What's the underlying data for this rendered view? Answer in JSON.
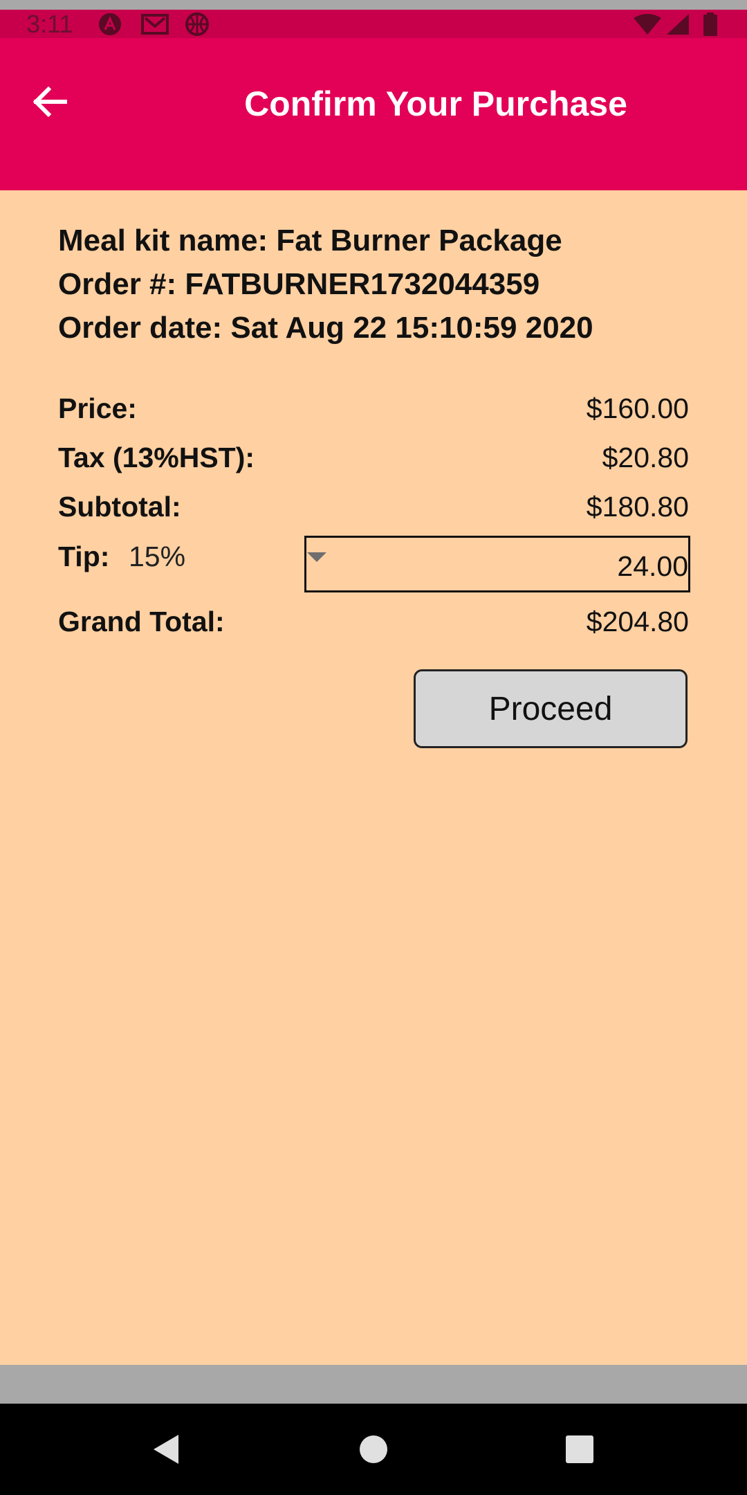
{
  "status_bar": {
    "time": "3:11",
    "icons_left": [
      "android-icon",
      "mail-icon",
      "basketball-icon"
    ],
    "icons_right": [
      "wifi-icon",
      "signal-icon",
      "battery-icon"
    ],
    "color": "#c8004c"
  },
  "app_bar": {
    "title": "Confirm Your Purchase",
    "color": "#e30057"
  },
  "order": {
    "meal_kit_line": "Meal kit name: Fat Burner Package",
    "order_number_line": "Order #: FATBURNER1732044359",
    "order_date_line": "Order date: Sat Aug 22 15:10:59 2020"
  },
  "summary": {
    "price_label": "Price:",
    "price_value": "$160.00",
    "tax_label": "Tax (13%HST):",
    "tax_value": "$20.80",
    "subtotal_label": "Subtotal:",
    "subtotal_value": "$180.80",
    "tip_label": "Tip:",
    "tip_percent": "15%",
    "tip_amount": "24.00",
    "grand_total_label": "Grand Total:",
    "grand_total_value": "$204.80"
  },
  "actions": {
    "proceed_label": "Proceed"
  },
  "colors": {
    "background": "#ffd0a2",
    "button": "#d6d6d6"
  }
}
